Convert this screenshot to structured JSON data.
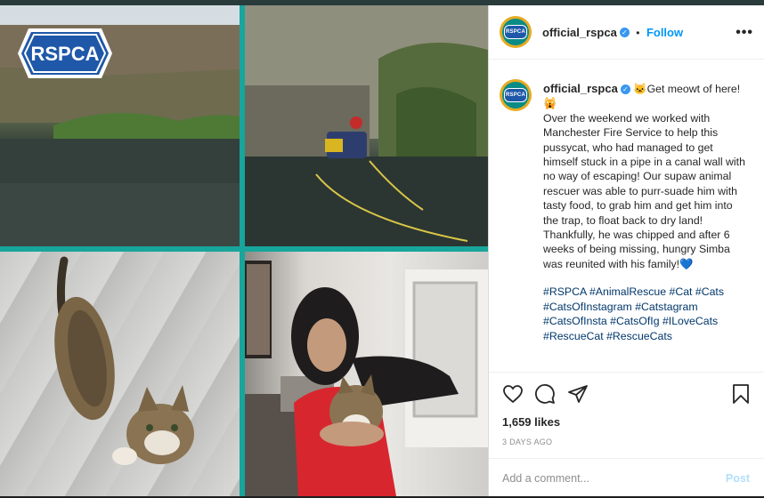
{
  "post_header": {
    "username": "official_rspca",
    "separator": "•",
    "follow_label": "Follow",
    "more_label": "•••",
    "avatar_text": "RSPCA"
  },
  "collage": {
    "logo_text": "RSPCA"
  },
  "caption": {
    "username": "official_rspca",
    "text_intro": "Get meowt of here!",
    "text_body": "Over the weekend we worked with Manchester Fire Service to help this pussycat, who had managed to get himself stuck in a pipe in a canal wall with no way of escaping! Our supaw animal rescuer was able to purr-suade him with tasty food, to grab him and get him into the trap, to float back to dry land! Thankfully, he was chipped and after 6 weeks of being missing, hungry Simba was reunited with his family!",
    "hashtags_line1": "#RSPCA #AnimalRescue #Cat #Cats",
    "hashtags_line2": "#CatsOfInstagram #Catstagram",
    "hashtags_line3": "#CatsOfInsta #CatsOfIg #ILoveCats",
    "hashtags_line4": "#RescueCat #RescueCats"
  },
  "stats": {
    "likes": "1,659 likes",
    "time_ago": "3 DAYS AGO"
  },
  "comment": {
    "placeholder": "Add a comment...",
    "post_label": "Post"
  },
  "colors": {
    "accent": "#0095f6",
    "collage_border": "#17a59c",
    "rspca_blue": "#1f58a8"
  }
}
